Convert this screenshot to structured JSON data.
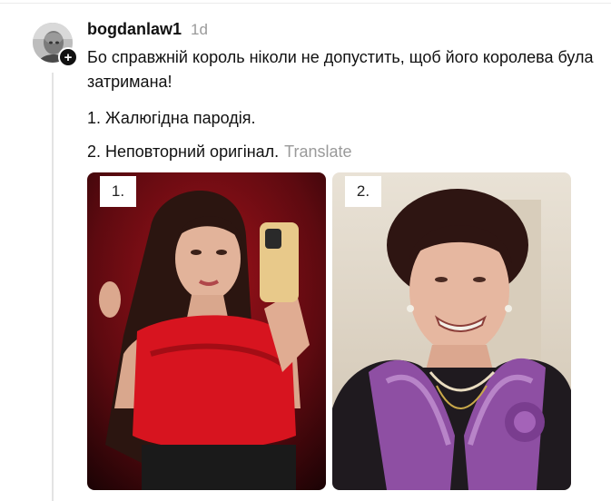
{
  "comment": {
    "username": "bogdanlaw1",
    "timestamp": "1d",
    "follow_symbol": "+",
    "paragraphs": [
      "Бо справжній король ніколи не допустить, щоб його королева була затримана!",
      "1. Жалюгідна пародія.",
      "2. Неповторний оригінал."
    ],
    "translate_label": "Translate"
  },
  "images": [
    {
      "label": "1.",
      "icon": "photo-woman-red-dress"
    },
    {
      "label": "2.",
      "icon": "photo-woman-purple-blouse"
    }
  ],
  "colors": {
    "text": "#111111",
    "muted": "#9a9a9a",
    "thread_line": "#e3e3e3",
    "badge": "#111111"
  }
}
